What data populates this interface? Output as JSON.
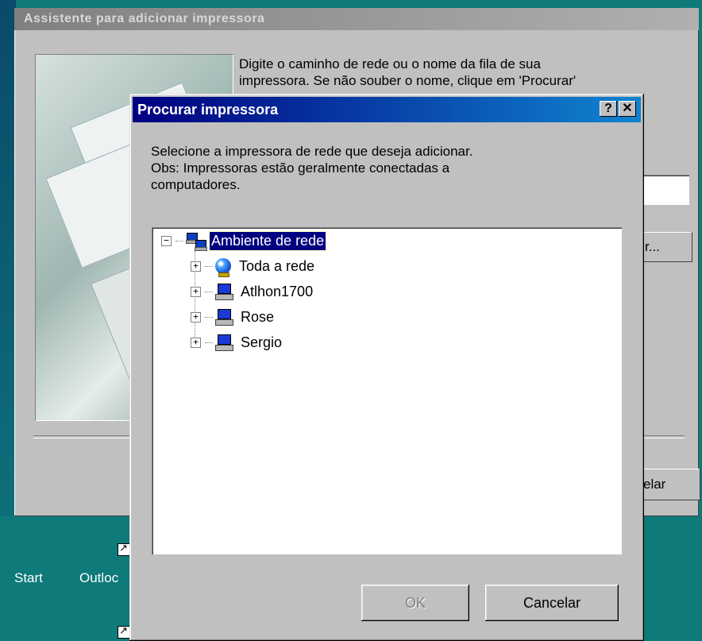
{
  "desktop": {
    "start_label": "Start",
    "outlook_label": "Outloc"
  },
  "wizard": {
    "title": "Assistente para adicionar impressora",
    "instruction_line1": "Digite o caminho de rede ou o nome da fila de sua",
    "instruction_line2": "impressora. Se não souber o nome, clique em 'Procurar'",
    "browse_label": "r...",
    "cancel_label": "elar"
  },
  "dialog": {
    "title": "Procurar impressora",
    "help_label": "?",
    "close_label": "✕",
    "desc_line1": "Selecione a impressora de rede que deseja adicionar.",
    "desc_line2": "Obs: Impressoras estão geralmente conectadas a",
    "desc_line3": "computadores.",
    "ok_label": "OK",
    "cancel_label": "Cancelar"
  },
  "tree": {
    "root": {
      "label": "Ambiente de rede",
      "icon": "network-neighborhood-icon",
      "expander": "−"
    },
    "items": [
      {
        "label": "Toda a rede",
        "icon": "entire-network-icon",
        "expander": "+"
      },
      {
        "label": "Atlhon1700",
        "icon": "computer-icon",
        "expander": "+"
      },
      {
        "label": "Rose",
        "icon": "computer-icon",
        "expander": "+"
      },
      {
        "label": "Sergio",
        "icon": "computer-icon",
        "expander": "+"
      }
    ]
  },
  "colors": {
    "title_active": "#000080",
    "title_inactive": "#808080",
    "window_face": "#c0c0c0",
    "desktop": "#0e7a7a",
    "selection": "#000080"
  }
}
